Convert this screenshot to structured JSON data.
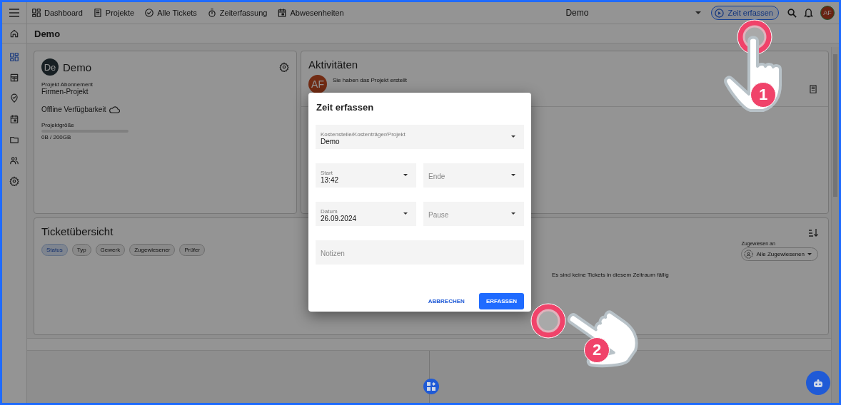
{
  "topbar": {
    "nav": [
      {
        "label": "Dashboard"
      },
      {
        "label": "Projekte"
      },
      {
        "label": "Alle Tickets"
      },
      {
        "label": "Zeiterfassung"
      },
      {
        "label": "Abwesenheiten"
      }
    ],
    "project_select": "Demo",
    "time_button": "Zeit erfassen",
    "avatar": "AF"
  },
  "sidebar": {
    "items": [
      {
        "selected": false
      },
      {
        "selected": true
      },
      {
        "selected": false
      },
      {
        "selected": false
      },
      {
        "selected": false
      },
      {
        "selected": false
      },
      {
        "selected": false
      },
      {
        "selected": false
      }
    ]
  },
  "breadcrumb": "Demo",
  "project_card": {
    "avatar": "De",
    "title": "Demo",
    "subscription_label": "Projekt Abonnement",
    "subscription": "Firmen-Projekt",
    "offline": "Offline Verfügbarkeit",
    "size_label": "Projektgröße",
    "level": 0,
    "size_text": "0B / 200GB"
  },
  "activities": {
    "title": "Aktivitäten",
    "items": [
      {
        "avatar": "AF",
        "text": "Sie haben das Projekt erstellt"
      }
    ]
  },
  "tickets": {
    "title": "Ticketübersicht",
    "filters": [
      {
        "label": "Status",
        "selected": true
      },
      {
        "label": "Typ",
        "selected": false
      },
      {
        "label": "Gewerk",
        "selected": false
      },
      {
        "label": "Zugewiesener",
        "selected": false
      },
      {
        "label": "Prüfer",
        "selected": false
      }
    ],
    "assigned_label": "Zugewiesen an",
    "assigned_value": "Alle Zugewiesenen",
    "empty": "Es sind keine Tickets in diesem Zeitraum fällig"
  },
  "dialog": {
    "title": "Zeit erfassen",
    "fields": [
      {
        "kind": "wideselect",
        "label": "Kostenstelle/Kostenträger/Projekt",
        "value": "Demo"
      },
      {
        "kind": "select",
        "label": "Start",
        "value": "13:42"
      },
      {
        "kind": "select",
        "placeholder": "Ende"
      },
      {
        "kind": "select",
        "label": "Datum",
        "value": "26.09.2024"
      },
      {
        "kind": "select",
        "placeholder": "Pause"
      },
      {
        "kind": "notes",
        "placeholder": "Notizen"
      }
    ],
    "cancel": "ABBRECHEN",
    "submit": "ERFASSEN"
  },
  "annotations": [
    {
      "number": "1"
    },
    {
      "number": "2"
    }
  ]
}
